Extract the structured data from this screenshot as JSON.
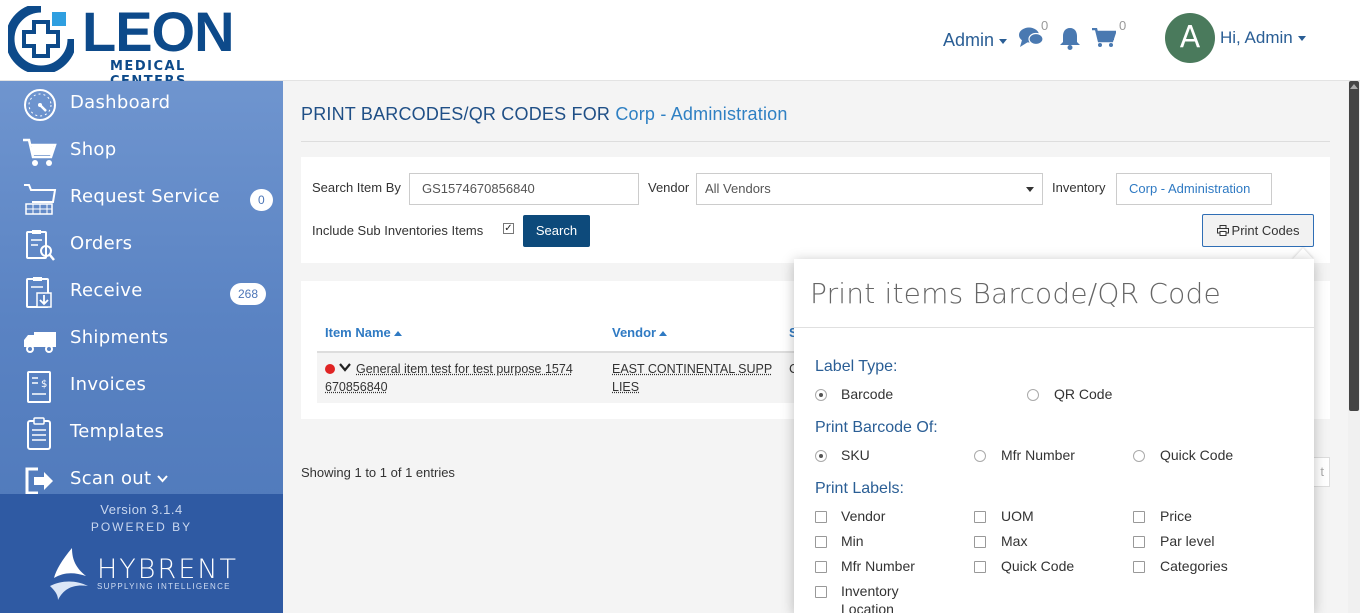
{
  "brand": {
    "word": "LEON",
    "sub": "MEDICAL CENTERS",
    "primary_color": "#0d4a8a",
    "accent_color": "#2f80c3"
  },
  "header": {
    "admin_label": "Admin",
    "messages_count": "0",
    "cart_count": "0",
    "avatar_letter": "A",
    "greeting": "Hi, Admin"
  },
  "sidebar": {
    "items": [
      {
        "label": "Dashboard",
        "icon": "dashboard-gauge-icon"
      },
      {
        "label": "Shop",
        "icon": "cart-icon"
      },
      {
        "label": "Request Service",
        "icon": "request-service-icon",
        "badge": "0"
      },
      {
        "label": "Orders",
        "icon": "orders-icon"
      },
      {
        "label": "Receive",
        "icon": "receive-icon",
        "badge": "268"
      },
      {
        "label": "Shipments",
        "icon": "truck-icon"
      },
      {
        "label": "Invoices",
        "icon": "invoice-icon"
      },
      {
        "label": "Templates",
        "icon": "clipboard-icon"
      },
      {
        "label": "Scan out",
        "icon": "scan-out-icon"
      }
    ],
    "version": "Version 3.1.4",
    "powered_by": "POWERED BY",
    "partner_word": "HYBRENT",
    "partner_tagline": "SUPPLYING INTELLIGENCE"
  },
  "page": {
    "title_prefix": "PRINT BARCODES/QR CODES FOR",
    "title_accent": "Corp - Administration"
  },
  "filters": {
    "search_by_label": "Search Item By",
    "search_value": "GS1574670856840",
    "vendor_label": "Vendor",
    "vendor_value": "All Vendors",
    "inventory_label": "Inventory",
    "inventory_value": "Corp - Administration",
    "include_sub_label": "Include Sub Inventories Items",
    "include_sub_checked": true,
    "search_button": "Search",
    "print_button": "Print Codes"
  },
  "table": {
    "columns": [
      "Item Name",
      "Vendor",
      "S"
    ],
    "rows": [
      {
        "item_name_line1": "General item test for test purpose 1574",
        "item_name_line2": "670856840",
        "vendor_line1": "EAST CONTINENTAL SUPP",
        "vendor_line2": "LIES",
        "third": "C"
      }
    ],
    "showing": "Showing 1 to 1 of 1 entries",
    "partial_right": "t"
  },
  "popover": {
    "title": "Print items Barcode/QR Code",
    "label_type": {
      "heading": "Label Type:",
      "options": [
        "Barcode",
        "QR Code"
      ],
      "selected": "Barcode"
    },
    "barcode_of": {
      "heading": "Print Barcode Of:",
      "options": [
        "SKU",
        "Mfr Number",
        "Quick Code"
      ],
      "selected": "SKU"
    },
    "labels": {
      "heading": "Print Labels:",
      "options": [
        "Vendor",
        "UOM",
        "Price",
        "Min",
        "Max",
        "Par level",
        "Mfr Number",
        "Quick Code",
        "Categories",
        "Inventory",
        "Location"
      ]
    }
  }
}
